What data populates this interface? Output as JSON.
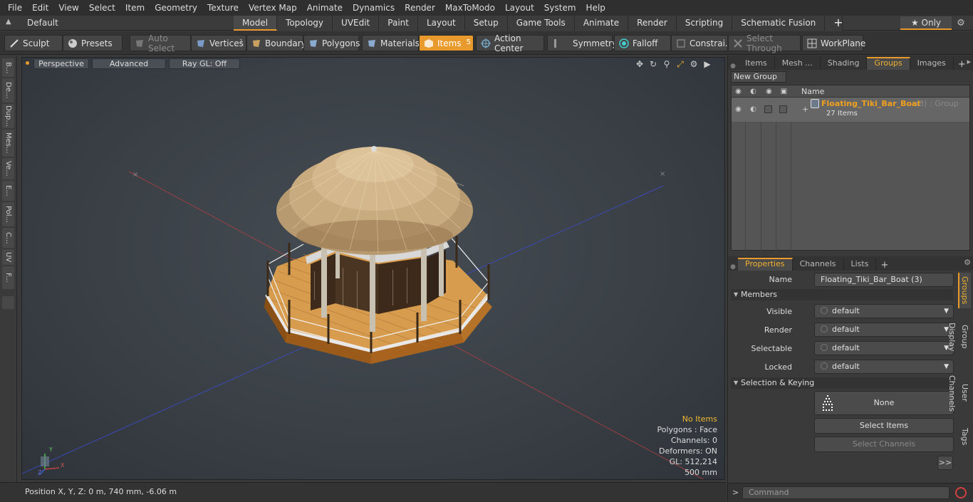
{
  "menu": [
    "File",
    "Edit",
    "View",
    "Select",
    "Item",
    "Geometry",
    "Texture",
    "Vertex Map",
    "Animate",
    "Dynamics",
    "Render",
    "MaxToModo",
    "Layout",
    "System",
    "Help"
  ],
  "layout": {
    "selector": "Default Layouts",
    "tabs": [
      "Model",
      "Topology",
      "UVEdit",
      "Paint",
      "Layout",
      "Setup",
      "Game Tools",
      "Animate",
      "Render",
      "Scripting",
      "Schematic Fusion"
    ],
    "active_tab": "Model",
    "only_label": "★  Only"
  },
  "toolbar": {
    "sculpt": "Sculpt",
    "presets": "Presets",
    "auto_select": "Auto Select",
    "vertices": "Vertices",
    "vertices_count": "1",
    "boundary": "Boundary",
    "polygons": "Polygons",
    "materials": "Materials",
    "items": "Items",
    "items_count": "5",
    "action_center": "Action Center",
    "symmetry": "Symmetry",
    "falloff": "Falloff",
    "constraints": "Constrai...",
    "select_through": "Select Through",
    "workplane": "WorkPlane"
  },
  "left_tabs": [
    "B...",
    "De...",
    "Dup...",
    "Mes...",
    "Ve...",
    "E...",
    "Pol...",
    "C...",
    "UV",
    "F..."
  ],
  "viewport": {
    "view": "Perspective",
    "shading": "Advanced",
    "raygl": "Ray GL: Off",
    "info": {
      "items": "No Items",
      "polygons": "Polygons : Face",
      "channels": "Channels: 0",
      "deformers": "Deformers: ON",
      "gl": "GL: 512,214",
      "scale": "500 mm"
    },
    "axis_y": "Y",
    "axis_x": "X",
    "axis_z": "Z"
  },
  "status": {
    "position": "Position X, Y, Z:   0 m, 740 mm, -6.06 m"
  },
  "panel_top": {
    "tabs": [
      "Items",
      "Mesh ...",
      "Shading",
      "Groups",
      "Images"
    ],
    "active": "Groups",
    "new_group": "New Group",
    "name_header": "Name",
    "group": {
      "name": "Floating_Tiki_Bar_Boat",
      "type": "(3) : Group",
      "count": "27 Items"
    }
  },
  "panel_bottom": {
    "tabs": [
      "Properties",
      "Channels",
      "Lists"
    ],
    "active": "Properties",
    "name_label": "Name",
    "name_value": "Floating_Tiki_Bar_Boat (3)",
    "members_section": "Members",
    "visible_label": "Visible",
    "visible_value": "default",
    "render_label": "Render",
    "render_value": "default",
    "selectable_label": "Selectable",
    "selectable_value": "default",
    "locked_label": "Locked",
    "locked_value": "default",
    "sel_section": "Selection & Keying",
    "none_label": "None",
    "select_items": "Select Items",
    "select_channels": "Select Channels",
    "expand": ">>",
    "vtabs": [
      "Groups",
      "Group Display",
      "User Channels",
      "Tags"
    ]
  },
  "command": {
    "prompt": ">",
    "placeholder": "Command"
  },
  "colors": {
    "accent": "#e89a2c",
    "group_name": "#f0a020"
  }
}
